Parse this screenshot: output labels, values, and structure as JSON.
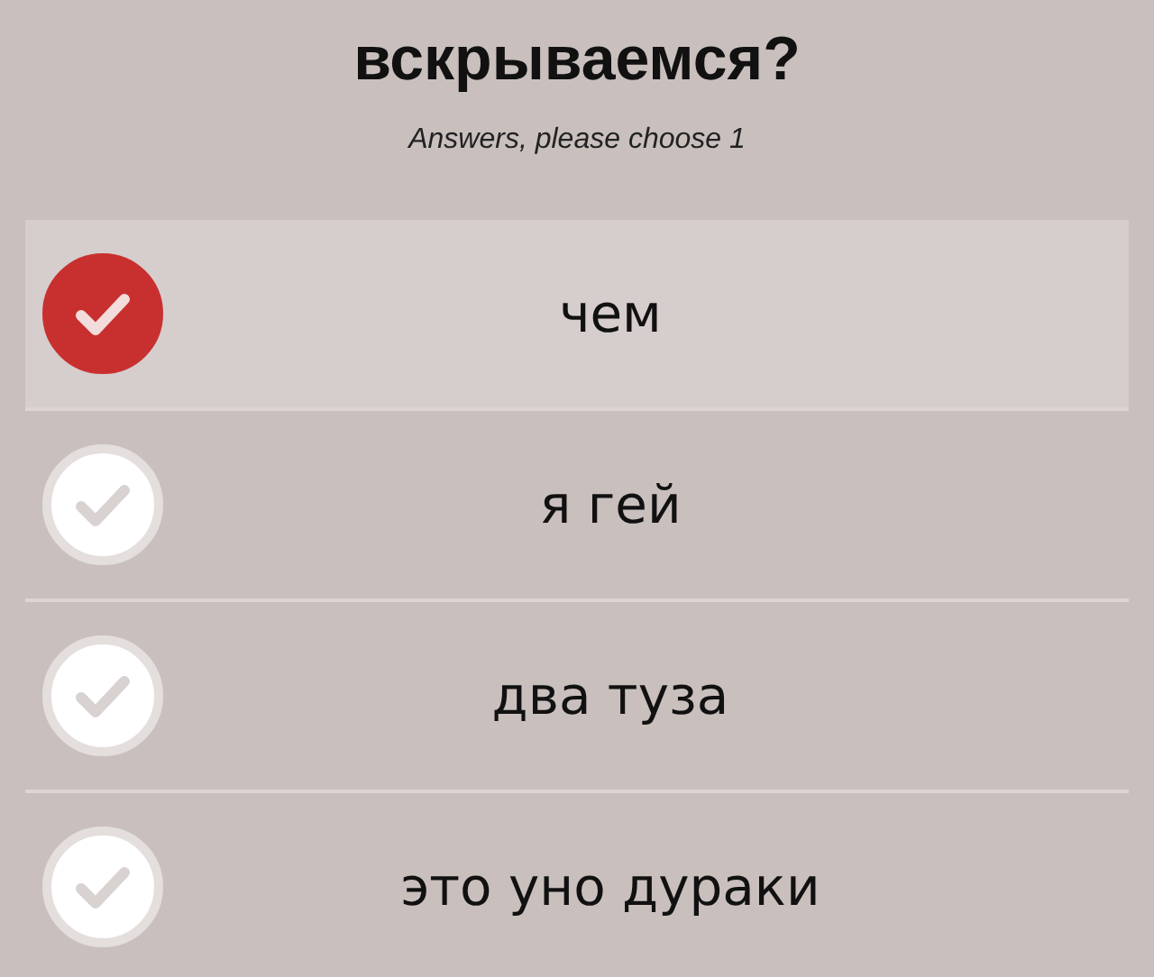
{
  "question": "вскрываемся?",
  "hint": "Answers, please choose 1",
  "answers": [
    {
      "label": "чем",
      "selected": true
    },
    {
      "label": "я гей",
      "selected": false
    },
    {
      "label": "два туза",
      "selected": false
    },
    {
      "label": "это уно дураки",
      "selected": false
    }
  ]
}
